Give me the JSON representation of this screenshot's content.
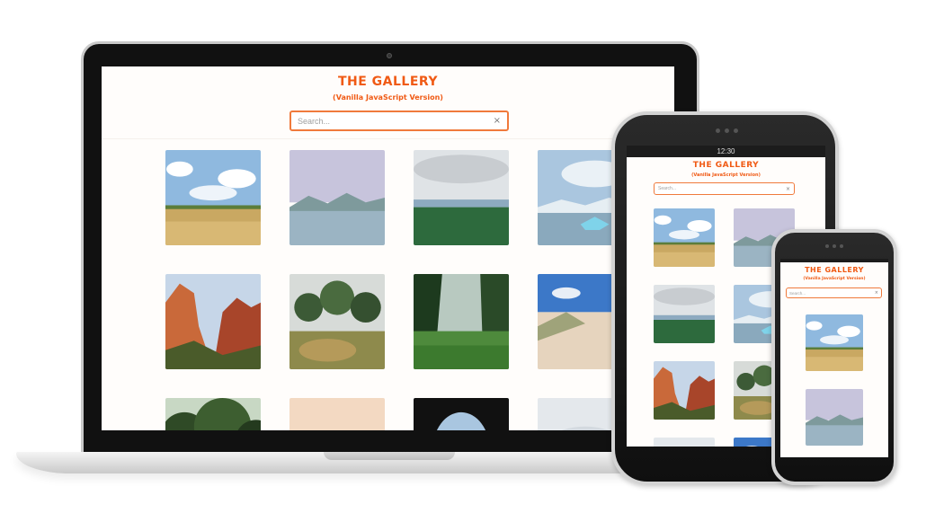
{
  "app": {
    "title": "THE GALLERY",
    "subtitle": "(Vanilla JavaScript Version)",
    "search_placeholder": "Search...",
    "clear_label": "×"
  },
  "tablet": {
    "status_time": "12:30"
  },
  "colors": {
    "accent": "#f05a14",
    "search_border": "#f07a3c"
  },
  "gallery": {
    "images": [
      "field-with-clouds",
      "misty-lake-mountains",
      "green-meadow-lake",
      "iceberg-lagoon",
      "red-rock-canyon",
      "desert-garden-trees",
      "green-valley-trail",
      "sand-dune-beach",
      "forest-canopy",
      "hazy-peach-sky",
      "cave-opening-sky",
      "pale-overcast-sky"
    ]
  }
}
